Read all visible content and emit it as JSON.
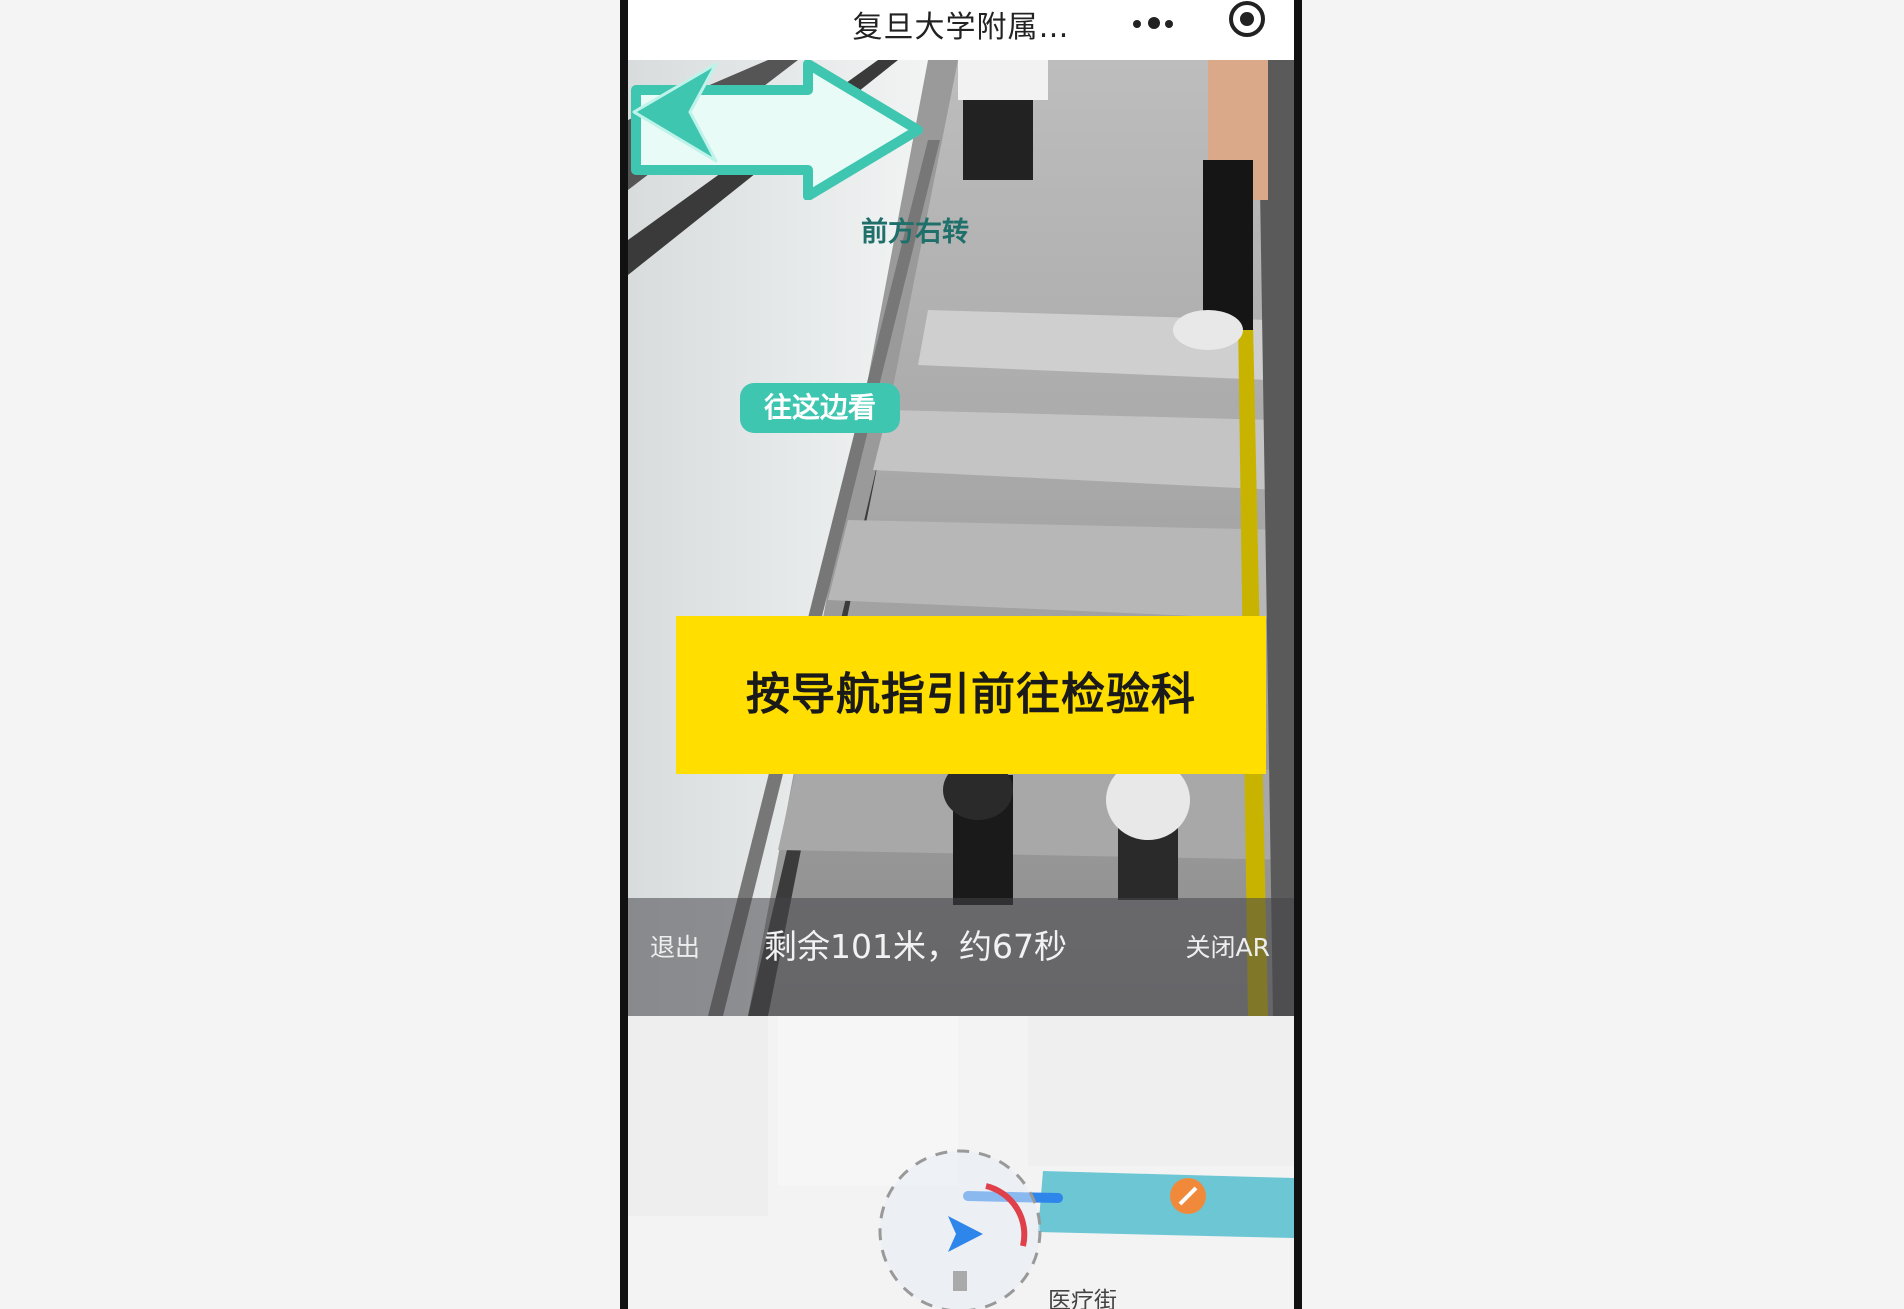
{
  "window": {
    "title": "复旦大学附属…"
  },
  "ar_view": {
    "turn_sign": "前方右转",
    "look_sign": "往这边看",
    "instruction": "按导航指引前往检验科",
    "status": {
      "exit_label": "退出",
      "remaining": "剩余101米，约67秒",
      "close_ar_label": "关闭AR"
    }
  },
  "map": {
    "road_label": "医疗街"
  },
  "colors": {
    "ar_teal": "#3fc6b1",
    "banner_yellow": "#ffde00",
    "route_blue": "#2f86ea",
    "heading_red": "#e0404a",
    "map_street": "#6cc6d4"
  },
  "icons": {
    "menu": "more-dots-icon",
    "capsule": "target-close-icon",
    "turn": "arrow-right-icon",
    "look": "chevron-left-icon",
    "location": "location-arrow-icon",
    "poi": "restaurant-pin-icon"
  }
}
